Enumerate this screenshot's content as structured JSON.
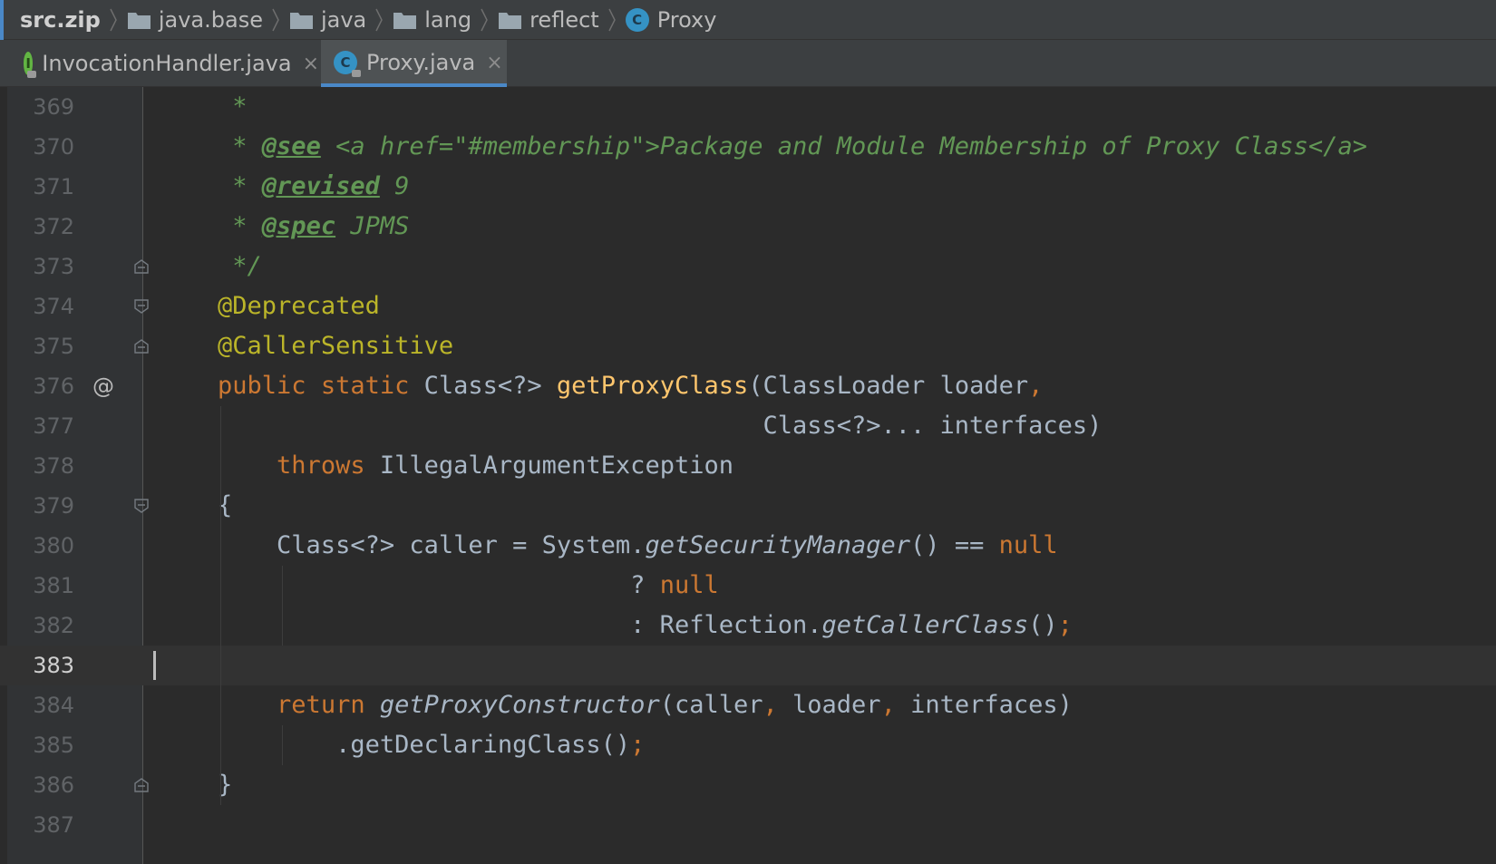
{
  "breadcrumb": [
    {
      "label": "src.zip",
      "icon": "none"
    },
    {
      "label": "java.base",
      "icon": "folder-icon"
    },
    {
      "label": "java",
      "icon": "folder-icon"
    },
    {
      "label": "lang",
      "icon": "folder-icon"
    },
    {
      "label": "reflect",
      "icon": "folder-icon"
    },
    {
      "label": "Proxy",
      "icon": "class-icon"
    }
  ],
  "tabs": [
    {
      "label": "InvocationHandler.java",
      "icon_letter": "I",
      "icon": "interface-icon",
      "close": "×",
      "active": false
    },
    {
      "label": "Proxy.java",
      "icon_letter": "C",
      "icon": "class-icon",
      "close": "×",
      "active": true
    }
  ],
  "editor": {
    "current_line": "383",
    "lines": [
      {
        "num": "369",
        "tokens": [
          {
            "t": "     *",
            "c": "cm"
          }
        ]
      },
      {
        "num": "370",
        "tokens": [
          {
            "t": "     * ",
            "c": "cm"
          },
          {
            "t": "@see",
            "c": "cmt"
          },
          {
            "t": " <a href=\"#membership\">Package and Module Membership of Proxy Class</a>",
            "c": "cm"
          }
        ]
      },
      {
        "num": "371",
        "tokens": [
          {
            "t": "     * ",
            "c": "cm"
          },
          {
            "t": "@revised",
            "c": "cmt"
          },
          {
            "t": " 9",
            "c": "cm"
          }
        ]
      },
      {
        "num": "372",
        "tokens": [
          {
            "t": "     * ",
            "c": "cm"
          },
          {
            "t": "@spec",
            "c": "cmt"
          },
          {
            "t": " JPMS",
            "c": "cm"
          }
        ]
      },
      {
        "num": "373",
        "tokens": [
          {
            "t": "     */",
            "c": "cm"
          }
        ]
      },
      {
        "num": "374",
        "tokens": [
          {
            "t": "    ",
            "c": ""
          },
          {
            "t": "@Deprecated",
            "c": "ann"
          }
        ]
      },
      {
        "num": "375",
        "tokens": [
          {
            "t": "    ",
            "c": ""
          },
          {
            "t": "@CallerSensitive",
            "c": "ann"
          }
        ]
      },
      {
        "num": "376",
        "tokens": [
          {
            "t": "    ",
            "c": ""
          },
          {
            "t": "public static ",
            "c": "kw"
          },
          {
            "t": "Class<?> ",
            "c": ""
          },
          {
            "t": "getProxyClass",
            "c": "fn"
          },
          {
            "t": "(ClassLoader loader",
            "c": ""
          },
          {
            "t": ",",
            "c": "kw"
          }
        ]
      },
      {
        "num": "377",
        "tokens": [
          {
            "t": "                                         Class<?>... interfaces)",
            "c": ""
          }
        ]
      },
      {
        "num": "378",
        "tokens": [
          {
            "t": "        ",
            "c": ""
          },
          {
            "t": "throws ",
            "c": "kw"
          },
          {
            "t": "IllegalArgumentException",
            "c": ""
          }
        ]
      },
      {
        "num": "379",
        "tokens": [
          {
            "t": "    {",
            "c": ""
          }
        ]
      },
      {
        "num": "380",
        "tokens": [
          {
            "t": "        Class<?> caller = System.",
            "c": ""
          },
          {
            "t": "getSecurityManager",
            "c": "it"
          },
          {
            "t": "() == ",
            "c": ""
          },
          {
            "t": "null",
            "c": "kw"
          }
        ]
      },
      {
        "num": "381",
        "tokens": [
          {
            "t": "                                ? ",
            "c": ""
          },
          {
            "t": "null",
            "c": "kw"
          }
        ]
      },
      {
        "num": "382",
        "tokens": [
          {
            "t": "                                : Reflection.",
            "c": ""
          },
          {
            "t": "getCallerClass",
            "c": "it"
          },
          {
            "t": "()",
            "c": ""
          },
          {
            "t": ";",
            "c": "kw"
          }
        ]
      },
      {
        "num": "383",
        "tokens": []
      },
      {
        "num": "384",
        "tokens": [
          {
            "t": "        ",
            "c": ""
          },
          {
            "t": "return ",
            "c": "kw"
          },
          {
            "t": "getProxyConstructor",
            "c": "it"
          },
          {
            "t": "(caller",
            "c": ""
          },
          {
            "t": ", ",
            "c": "kw"
          },
          {
            "t": "loader",
            "c": ""
          },
          {
            "t": ", ",
            "c": "kw"
          },
          {
            "t": "interfaces)",
            "c": ""
          }
        ]
      },
      {
        "num": "385",
        "tokens": [
          {
            "t": "            .getDeclaringClass()",
            "c": ""
          },
          {
            "t": ";",
            "c": "kw"
          }
        ]
      },
      {
        "num": "386",
        "tokens": [
          {
            "t": "    }",
            "c": ""
          }
        ]
      },
      {
        "num": "387",
        "tokens": []
      }
    ],
    "gutter_markers": {
      "376": "@"
    },
    "fold_markers": {
      "373": "fold-end-icon",
      "374": "fold-start-icon",
      "375": "fold-end-icon",
      "379": "fold-start-icon",
      "386": "fold-end-icon"
    }
  },
  "colors": {
    "keyword": "#cc7832",
    "comment": "#629755",
    "annotation": "#bbb529",
    "method_decl": "#ffc66d",
    "text": "#a9b7c6",
    "tab_underline": "#4a88c7"
  }
}
